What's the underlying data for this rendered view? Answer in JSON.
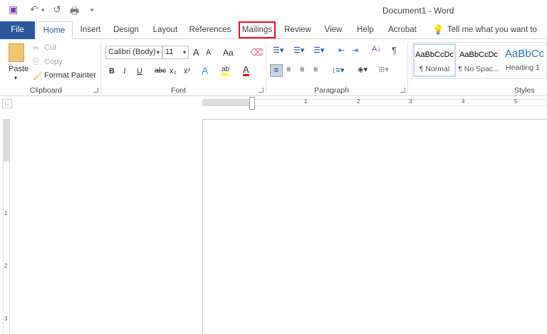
{
  "title": "Document1  -  Word",
  "qat": {
    "save_icon": "save-icon",
    "undo_icon": "undo-icon",
    "redo_icon": "redo-icon",
    "print_icon": "print-preview-icon",
    "customize": "▾"
  },
  "tabs": [
    "File",
    "Home",
    "Insert",
    "Design",
    "Layout",
    "References",
    "Mailings",
    "Review",
    "View",
    "Help",
    "Acrobat"
  ],
  "tell_me": "Tell me what you want to do",
  "highlight_color": "#e81123",
  "clipboard": {
    "paste": "Paste",
    "cut": "Cut",
    "copy": "Copy",
    "format_painter": "Format Painter",
    "label": "Clipboard"
  },
  "font": {
    "name": "Calibri (Body)",
    "size": "11",
    "grow": "A",
    "shrink": "A",
    "case": "Aa",
    "bold": "B",
    "italic": "I",
    "underline": "U",
    "strike": "abc",
    "sub": "x₂",
    "sup": "x²",
    "effects": "A",
    "highlight": "ab",
    "color": "A",
    "label": "Font"
  },
  "paragraph": {
    "label": "Paragraph",
    "pilcrow": "¶"
  },
  "styles": {
    "items": [
      {
        "preview": "AaBbCcDc",
        "name": "¶ Normal"
      },
      {
        "preview": "AaBbCcDc",
        "name": "¶ No Spac..."
      },
      {
        "preview": "AaBbCc",
        "name": "Heading 1"
      }
    ],
    "label": "Styles"
  },
  "ruler": {
    "h": [
      "1",
      "2",
      "3",
      "4",
      "5"
    ],
    "v": [
      "1",
      "2",
      "3"
    ]
  }
}
